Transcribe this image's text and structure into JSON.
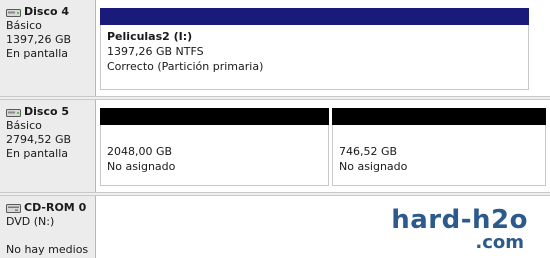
{
  "disks": [
    {
      "name": "Disco 4",
      "type": "Básico",
      "size": "1397,26 GB",
      "status": "En pantalla",
      "partitions": [
        {
          "title": "Peliculas2  (I:)",
          "size": "1397,26 GB NTFS",
          "status": "Correcto (Partición primaria)",
          "bar_color": "#1a1a7a"
        }
      ]
    },
    {
      "name": "Disco 5",
      "type": "Básico",
      "size": "2794,52 GB",
      "status": "En pantalla",
      "partitions": [
        {
          "size": "2048,00 GB",
          "status": "No asignado",
          "bar_color": "#000000"
        },
        {
          "size": "746,52 GB",
          "status": "No asignado",
          "bar_color": "#000000"
        }
      ]
    },
    {
      "name": "CD-ROM 0",
      "type": "DVD (N:)",
      "status": "No hay medios"
    }
  ],
  "watermark": {
    "main": "hard-h2o",
    "sub": ".com",
    "color": "#2d5a8c"
  },
  "icons": {
    "disk": "hard-disk-icon",
    "cdrom": "cdrom-drive-icon"
  }
}
